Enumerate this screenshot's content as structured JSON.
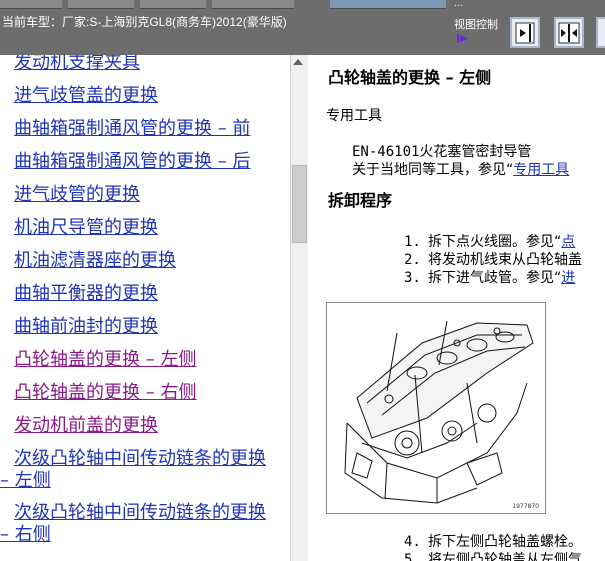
{
  "header": {
    "vehicle_label": "当前车型：厂家:S-上海别克GL8(商务车)2012(豪华版)",
    "view_control_label": "视图控制",
    "top_dots": "..."
  },
  "nav": {
    "items": [
      {
        "label": "发动机支撑夹具",
        "visited": false
      },
      {
        "label": "进气歧管盖的更换",
        "visited": false
      },
      {
        "label": "曲轴箱强制通风管的更换 – 前",
        "visited": false
      },
      {
        "label": "曲轴箱强制通风管的更换 – 后",
        "visited": false
      },
      {
        "label": "进气歧管的更换",
        "visited": false
      },
      {
        "label": "机油尺导管的更换",
        "visited": false
      },
      {
        "label": "机油滤清器座的更换",
        "visited": false
      },
      {
        "label": "曲轴平衡器的更换",
        "visited": false
      },
      {
        "label": "曲轴前油封的更换",
        "visited": false
      },
      {
        "label": "凸轮轴盖的更换 – 左侧",
        "visited": true
      },
      {
        "label": "凸轮轴盖的更换 – 右侧",
        "visited": true
      },
      {
        "label": "发动机前盖的更换",
        "visited": true
      },
      {
        "label": "次级凸轮轴中间传动链条的更换 – 左侧",
        "visited": false
      },
      {
        "label": "次级凸轮轴中间传动链条的更换 – 右侧",
        "visited": false
      }
    ]
  },
  "content": {
    "title": "凸轮轴盖的更换 – 左侧",
    "special_tools_heading": "专用工具",
    "tool_line": "EN-46101火花塞管密封导管",
    "equivalent_prefix": "关于当地同等工具，参见“",
    "equivalent_link": "专用工具",
    "removal_heading": "拆卸程序",
    "steps": [
      {
        "num": "1.",
        "text": "拆下点火线圈。参见“",
        "link": "点"
      },
      {
        "num": "2.",
        "text": "将发动机线束从凸轮轴盖",
        "link": ""
      },
      {
        "num": "3.",
        "text": "拆下进气歧管。参见“",
        "link": "进"
      },
      {
        "num": "4.",
        "text": "拆下左侧凸轮轴盖螺栓。",
        "link": ""
      },
      {
        "num": "5.",
        "text": "将左侧凸轮轴盖从左侧气",
        "link": ""
      }
    ],
    "figure_id": "1977870"
  },
  "colors": {
    "header_bg": "#6d6d6d",
    "link": "#1f35b5",
    "visited_link": "#8a1a8a"
  }
}
